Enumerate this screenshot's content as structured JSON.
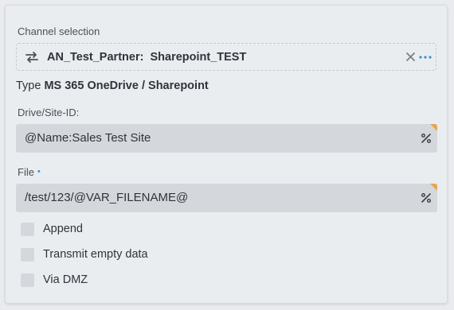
{
  "channel": {
    "label": "Channel selection",
    "partner": "AN_Test_Partner:",
    "name": "Sharepoint_TEST"
  },
  "type": {
    "prefix": "Type",
    "value": "MS 365 OneDrive / Sharepoint"
  },
  "drive": {
    "label": "Drive/Site-ID:",
    "value": "@Name:Sales Test Site"
  },
  "file": {
    "label": "File",
    "required_marker": "•",
    "value": "/test/123/@VAR_FILENAME@"
  },
  "options": [
    {
      "label": "Append",
      "checked": false
    },
    {
      "label": "Transmit empty data",
      "checked": false
    },
    {
      "label": "Via DMZ",
      "checked": false
    }
  ],
  "colors": {
    "accent": "#3a8fd6",
    "corner_marker": "#e8a64a",
    "field_bg": "#d4d8dd"
  },
  "icons": [
    "swap-icon",
    "close-icon",
    "more-icon",
    "percent-icon"
  ]
}
